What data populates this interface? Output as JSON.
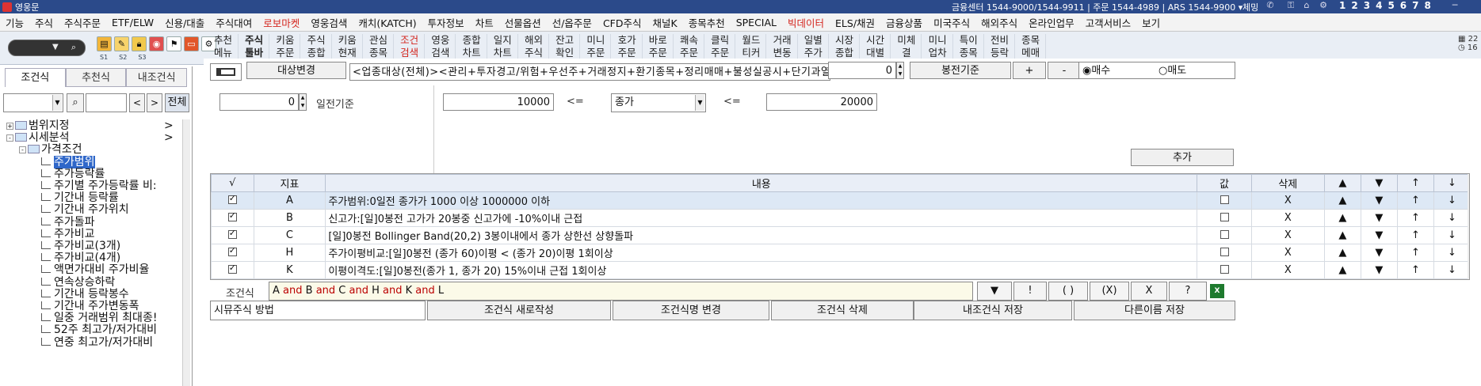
{
  "titlebar": {
    "title": "영웅문",
    "info": "금융센터 1544-9000/1544-9911 | 주문 1544-4989 | ARS 1544-9900 ▾",
    "check": "체밍",
    "pages": [
      "1",
      "2",
      "3",
      "4",
      "5",
      "6",
      "7",
      "8"
    ]
  },
  "menu": {
    "items": [
      "기능",
      "주식",
      "주식주문",
      "ETF/ELW",
      "신용/대출",
      "주식대여",
      "로보마켓",
      "영웅검색",
      "캐치(KATCH)",
      "투자정보",
      "차트",
      "선물옵션",
      "선/옵주문",
      "CFD주식",
      "채널K",
      "종목추천",
      "SPECIAL",
      "빅데이터",
      "ELS/채권",
      "금융상품",
      "미국주식",
      "해외주식",
      "온라인업무",
      "고객서비스",
      "보기"
    ],
    "red_items": [
      "로보마켓",
      "빅데이터"
    ]
  },
  "toolbar": {
    "sub_labels": [
      "S1",
      "S2",
      "S3"
    ],
    "buttons": [
      {
        "l1": "추천",
        "l2": "메뉴"
      },
      {
        "l1": "주식",
        "l2": "툴바"
      },
      {
        "l1": "키움",
        "l2": "주문"
      },
      {
        "l1": "주식",
        "l2": "종합"
      },
      {
        "l1": "키움",
        "l2": "현재"
      },
      {
        "l1": "관심",
        "l2": "종목"
      },
      {
        "l1": "조건",
        "l2": "검색"
      },
      {
        "l1": "영웅",
        "l2": "검색"
      },
      {
        "l1": "종합",
        "l2": "차트"
      },
      {
        "l1": "일지",
        "l2": "차트"
      },
      {
        "l1": "해외",
        "l2": "주식"
      },
      {
        "l1": "잔고",
        "l2": "확인"
      },
      {
        "l1": "미니",
        "l2": "주문"
      },
      {
        "l1": "호가",
        "l2": "주문"
      },
      {
        "l1": "바로",
        "l2": "주문"
      },
      {
        "l1": "쾌속",
        "l2": "주문"
      },
      {
        "l1": "클릭",
        "l2": "주문"
      },
      {
        "l1": "월드",
        "l2": "티커"
      },
      {
        "l1": "거래",
        "l2": "변동"
      },
      {
        "l1": "일별",
        "l2": "주가"
      },
      {
        "l1": "시장",
        "l2": "종합"
      },
      {
        "l1": "시간",
        "l2": "대별"
      },
      {
        "l1": "미체",
        "l2": "결"
      },
      {
        "l1": "미니",
        "l2": "업차"
      },
      {
        "l1": "특이",
        "l2": "종목"
      },
      {
        "l1": "전비",
        "l2": "등락"
      },
      {
        "l1": "종목",
        "l2": "메매"
      }
    ],
    "right_top": "22",
    "right_bottom": "16"
  },
  "left_panel": {
    "tabs": [
      "조건식",
      "추천식",
      "내조건식"
    ],
    "all_button": "전체",
    "tree": [
      {
        "label": "범위지정",
        "level": 0,
        "type": "folder",
        "expand": "+",
        "arrow": ">"
      },
      {
        "label": "시세분석",
        "level": 0,
        "type": "folder",
        "expand": "-",
        "arrow": ">"
      },
      {
        "label": "가격조건",
        "level": 1,
        "type": "folder",
        "expand": "-"
      },
      {
        "label": "주가범위",
        "level": 2,
        "type": "item",
        "selected": true
      },
      {
        "label": "주가등락률",
        "level": 2,
        "type": "item"
      },
      {
        "label": "주기별 주가등락률 비:",
        "level": 2,
        "type": "item"
      },
      {
        "label": "기간내 등락률",
        "level": 2,
        "type": "item"
      },
      {
        "label": "기간내 주가위치",
        "level": 2,
        "type": "item"
      },
      {
        "label": "주가돌파",
        "level": 2,
        "type": "item"
      },
      {
        "label": "주가비교",
        "level": 2,
        "type": "item"
      },
      {
        "label": "주가비교(3개)",
        "level": 2,
        "type": "item"
      },
      {
        "label": "주가비교(4개)",
        "level": 2,
        "type": "item"
      },
      {
        "label": "액면가대비 주가비율",
        "level": 2,
        "type": "item"
      },
      {
        "label": "연속상승하락",
        "level": 2,
        "type": "item"
      },
      {
        "label": "기간내 등락봉수",
        "level": 2,
        "type": "item"
      },
      {
        "label": "기간내 주가변동폭",
        "level": 2,
        "type": "item"
      },
      {
        "label": "일중 거래범위 최대종!",
        "level": 2,
        "type": "item"
      },
      {
        "label": "52주 최고가/저가대비",
        "level": 2,
        "type": "item"
      },
      {
        "label": "연중 최고가/저가대비",
        "level": 2,
        "type": "item"
      }
    ]
  },
  "main": {
    "change_target": "대상변경",
    "target_text": "<업종대상(전체)><관리+투자경고/위험+우선주+거래정지+환기종목+정리매매+불성실공시+단기과열+",
    "bar_offset": "0",
    "bar_basis": "봉전기준",
    "plus": "+",
    "minus": "-",
    "buy": "◉매수",
    "sell": "○매도",
    "day_offset": "0",
    "day_basis": "일전기준",
    "min_value": "10000",
    "le1": "<=",
    "price_type": "종가",
    "le2": "<=",
    "max_value": "20000",
    "add": "추가",
    "table": {
      "headers": [
        "√",
        "지표",
        "내용",
        "값",
        "삭제",
        "▲",
        "▼",
        "↑",
        "↓"
      ],
      "rows": [
        {
          "id": "A",
          "content": "주가범위:0일전 종가가 1000 이상 1000000 이하",
          "checked": true,
          "del": "X"
        },
        {
          "id": "B",
          "content": "신고가:[일]0봉전 고가가 20봉중 신고가에 -10%이내 근접",
          "checked": true,
          "del": "X"
        },
        {
          "id": "C",
          "content": "[일]0봉전 Bollinger Band(20,2) 3봉이내에서 종가 상한선 상향돌파",
          "checked": true,
          "del": "X"
        },
        {
          "id": "H",
          "content": "주가이평비교:[일]0봉전 (종가 60)이평 < (종가 20)이평 1회이상",
          "checked": true,
          "del": "X"
        },
        {
          "id": "K",
          "content": "이평이격도:[일]0봉전(종가 1, 종가 20) 15%이내 근접 1회이상",
          "checked": true,
          "del": "X"
        }
      ],
      "up_sym": "▲",
      "down_sym": "▼",
      "top_sym": "↑",
      "bottom_sym": "↓"
    },
    "expr_label": "조건식",
    "expression": [
      {
        "t": "A",
        "op": false
      },
      {
        "t": " and ",
        "op": true
      },
      {
        "t": "B",
        "op": false
      },
      {
        "t": " and ",
        "op": true
      },
      {
        "t": "C",
        "op": false
      },
      {
        "t": " and ",
        "op": true
      },
      {
        "t": "H",
        "op": false
      },
      {
        "t": " and ",
        "op": true
      },
      {
        "t": "K",
        "op": false
      },
      {
        "t": " and ",
        "op": true
      },
      {
        "t": "L",
        "op": false
      }
    ],
    "expr_buttons": [
      "▼",
      "!",
      "( )",
      "(X)",
      "X",
      "?"
    ],
    "bottom": {
      "placeholder": "시뮤주식 방법",
      "new": "조건식 새로작성",
      "rename": "조건식명 변경",
      "delete": "조건식 삭제",
      "save_mine": "내조건식 저장",
      "save_as": "다른이름 저장"
    }
  },
  "colors": {
    "title_bg": "#2b4a8a",
    "selection": "#2f67c9",
    "accent_red": "#d4261e"
  }
}
